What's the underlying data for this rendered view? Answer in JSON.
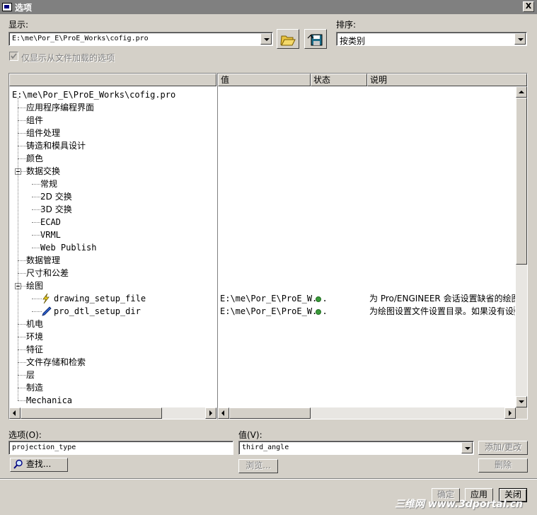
{
  "window": {
    "title": "选项",
    "close_glyph": "X"
  },
  "display": {
    "label": "显示:",
    "value": "E:\\me\\Por_E\\ProE_Works\\cofig.pro",
    "open_icon": "folder-open-icon",
    "save_icon": "save-config-icon",
    "checkbox_label": "仅显示从文件加载的选项",
    "checkbox_checked": true
  },
  "sort": {
    "label": "排序:",
    "value": "按类别"
  },
  "columns": {
    "value": "值",
    "status": "状态",
    "description": "说明"
  },
  "tree": {
    "root": "E:\\me\\Por_E\\ProE_Works\\cofig.pro",
    "items": [
      {
        "label": "应用程序编程界面"
      },
      {
        "label": "组件"
      },
      {
        "label": "组件处理"
      },
      {
        "label": "铸造和模具设计"
      },
      {
        "label": "颜色"
      },
      {
        "label": "数据交换",
        "expanded": true
      },
      {
        "label": "常规",
        "child": true
      },
      {
        "label": "2D 交换",
        "child": true
      },
      {
        "label": "3D 交换",
        "child": true
      },
      {
        "label": "ECAD",
        "child": true
      },
      {
        "label": "VRML",
        "child": true
      },
      {
        "label": "Web Publish",
        "child": true
      },
      {
        "label": "数据管理"
      },
      {
        "label": "尺寸和公差"
      },
      {
        "label": "绘图",
        "expanded": true
      },
      {
        "label": "drawing_setup_file",
        "child": true,
        "option": true
      },
      {
        "label": "pro_dtl_setup_dir",
        "child": true,
        "option": true
      },
      {
        "label": "机电"
      },
      {
        "label": "环境"
      },
      {
        "label": "特征"
      },
      {
        "label": "文件存储和检索"
      },
      {
        "label": "层"
      },
      {
        "label": "制造"
      },
      {
        "label": "Mechanica"
      }
    ]
  },
  "option_rows": [
    {
      "value": "E:\\me\\Por_E\\ProE_W...",
      "status_color": "#3a9a3a",
      "description": "为 Pro/ENGINEER 会话设置缺省的绘图\u0010"
    },
    {
      "value": "E:\\me\\Por_E\\ProE_W...",
      "status_color": "#3a9a3a",
      "description": "为绘图设置文件设置目录。如果没有设\u0010"
    }
  ],
  "editor": {
    "option_label": "选项(O):",
    "option_value": "projection_type",
    "value_label": "值(V):",
    "value_value": "third_angle",
    "add_change": "添加/更改",
    "find": "查找...",
    "browse": "浏览...",
    "delete": "删除"
  },
  "footer": {
    "ok": "确定",
    "apply": "应用",
    "close": "关闭"
  },
  "watermark": "三维网 www.3dportal.cn"
}
